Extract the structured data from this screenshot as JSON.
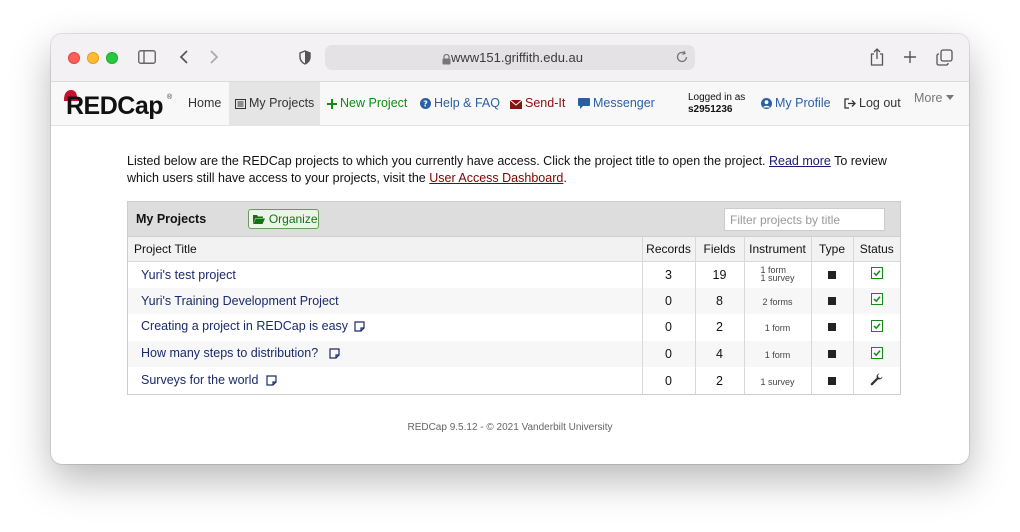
{
  "browser": {
    "url": "www151.griffith.edu.au"
  },
  "nav": {
    "logo": "REDCap",
    "logo_mark": "®",
    "items": [
      {
        "label": "Home"
      },
      {
        "label": "My Projects"
      },
      {
        "label": "New Project"
      },
      {
        "label": "Help & FAQ"
      },
      {
        "label": "Send-It"
      },
      {
        "label": "Messenger"
      }
    ],
    "logged_in_label": "Logged in as",
    "username": "s2951236",
    "my_profile": "My Profile",
    "log_out": "Log out",
    "more": "More"
  },
  "intro": {
    "text_1": "Listed below are the REDCap projects to which you currently have access. Click the project title to open the project. ",
    "read_more": "Read more",
    "text_2": " To review which users still have access to your projects, visit the ",
    "dashboard_link": "User Access Dashboard",
    "text_3": "."
  },
  "panel": {
    "title": "My Projects",
    "organize_label": "Organize",
    "filter_placeholder": "Filter projects by title",
    "columns": {
      "title": "Project Title",
      "records": "Records",
      "fields": "Fields",
      "instrument": "Instrument",
      "type": "Type",
      "status": "Status"
    },
    "rows": [
      {
        "title": "Yuri's test project",
        "records": "3",
        "fields": "19",
        "instr_1": "1 form",
        "instr_2": "1 survey",
        "status": "production"
      },
      {
        "title": "Yuri's Training Development Project",
        "records": "0",
        "fields": "8",
        "instr_1": "2 forms",
        "instr_2": "",
        "status": "production"
      },
      {
        "title": "Creating a project in REDCap is easy",
        "records": "0",
        "fields": "2",
        "instr_1": "1 form",
        "instr_2": "",
        "status": "production"
      },
      {
        "title": "How many steps to distribution?",
        "records": "0",
        "fields": "4",
        "instr_1": "1 form",
        "instr_2": "",
        "status": "production"
      },
      {
        "title": "Surveys for the world",
        "records": "0",
        "fields": "2",
        "instr_1": "1 survey",
        "instr_2": "",
        "status": "development"
      }
    ]
  },
  "footer": "REDCap 9.5.12 - © 2021 Vanderbilt University",
  "colors": {
    "accent_green": "#138a13",
    "link_blue": "#1a2a6c",
    "link_red": "#800000"
  }
}
